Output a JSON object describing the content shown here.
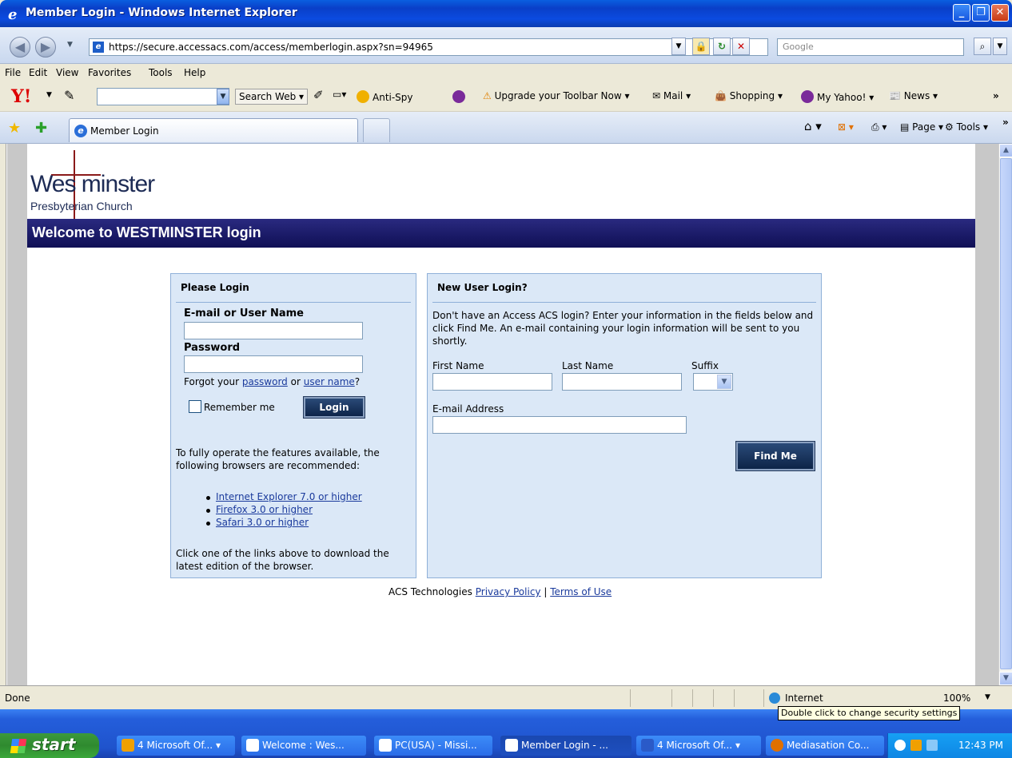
{
  "window": {
    "title": "Member Login - Windows Internet Explorer",
    "url": "https://secure.accessacs.com/access/memberlogin.aspx?sn=94965",
    "search_placeholder": "Google"
  },
  "menu": [
    "File",
    "Edit",
    "View",
    "Favorites",
    "Tools",
    "Help"
  ],
  "yahoo_toolbar": {
    "search_web": "Search Web",
    "anti_spy": "Anti-Spy",
    "upgrade": "Upgrade your Toolbar Now",
    "mail": "Mail",
    "shopping": "Shopping",
    "my_yahoo": "My Yahoo!",
    "news": "News",
    "more": "»"
  },
  "tabs": {
    "active": "Member Login",
    "page_menu": "Page",
    "tools_menu": "Tools"
  },
  "page": {
    "logo_line1": "Wes minster",
    "logo_line2": "Presbyterian Church",
    "banner_title": "Welcome to WESTMINSTER login",
    "login_panel": {
      "heading": "Please Login",
      "user_label": "E-mail or User Name",
      "user_value": "",
      "password_label": "Password",
      "password_value": "",
      "forgot_prefix": "Forgot your",
      "forgot_password": "password",
      "forgot_or": "or",
      "forgot_username": "user name",
      "forgot_suffix": "?",
      "remember_label": "Remember me",
      "login_button": "Login",
      "browsers_intro": "To fully operate the features available, the following browsers are recommended:",
      "browsers": [
        "Internet Explorer 7.0 or higher",
        "Firefox 3.0 or higher",
        "Safari 3.0 or higher"
      ],
      "browsers_outro": "Click one of the links above to download the latest edition of the browser."
    },
    "new_user_panel": {
      "heading": "New User Login?",
      "description": "Don't have an Access ACS login? Enter your information in the fields below and click Find Me. An e-mail containing your login information will be sent to you shortly.",
      "first_name_label": "First Name",
      "last_name_label": "Last Name",
      "suffix_label": "Suffix",
      "email_label": "E-mail Address",
      "find_button": "Find Me"
    },
    "footer": {
      "company": "ACS Technologies",
      "privacy": "Privacy Policy",
      "separator": "|",
      "terms": "Terms of Use"
    }
  },
  "status": {
    "text": "Done",
    "zone": "Internet",
    "zoom": "100%",
    "tooltip": "Double click to change security settings"
  },
  "taskbar": {
    "start": "start",
    "items": [
      "4 Microsoft Of...",
      "Welcome : Wes...",
      "PC(USA) - Missi...",
      "Member Login - ...",
      "4 Microsoft Of...",
      "Mediasation Co..."
    ],
    "clock": "12:43 PM"
  }
}
